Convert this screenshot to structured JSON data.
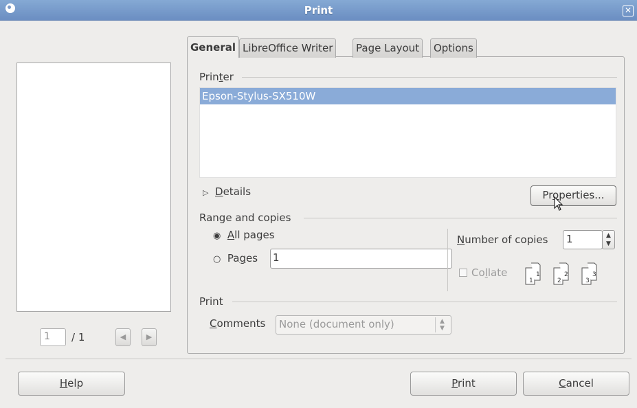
{
  "window": {
    "title": "Print",
    "close_glyph": "✕"
  },
  "preview": {
    "page_current": "1",
    "page_total": "/ 1",
    "prev_glyph": "◀",
    "next_glyph": "▶"
  },
  "tabs": [
    {
      "label": "General"
    },
    {
      "label": "LibreOffice Writer"
    },
    {
      "label": "Page Layout"
    },
    {
      "label": "Options"
    }
  ],
  "printer": {
    "section_pre": "Prin",
    "section_mn": "t",
    "section_post": "er",
    "selected": "Epson-Stylus-SX510W",
    "details_mn": "D",
    "details_post": "etails",
    "properties_pre": "Pr",
    "properties_mn": "o",
    "properties_post": "perties..."
  },
  "range": {
    "section": "Range and copies",
    "all_mn": "A",
    "all_post": "ll pages",
    "pages_pre": "Pa",
    "pages_mn": "g",
    "pages_post": "es",
    "pages_value": "1",
    "copies_mn": "N",
    "copies_post": "umber of copies",
    "copies_value": "1",
    "collate_pre": "Co",
    "collate_mn": "l",
    "collate_post": "late"
  },
  "print_section": {
    "section": "Print",
    "comments_mn": "C",
    "comments_post": "omments",
    "comments_value": "None (document only)"
  },
  "buttons": {
    "help_mn": "H",
    "help_post": "elp",
    "print_mn": "P",
    "print_post": "rint",
    "cancel_mn": "C",
    "cancel_post": "ancel"
  },
  "colors": {
    "titlebar": "#7799cc",
    "selection": "#8aabd8"
  }
}
